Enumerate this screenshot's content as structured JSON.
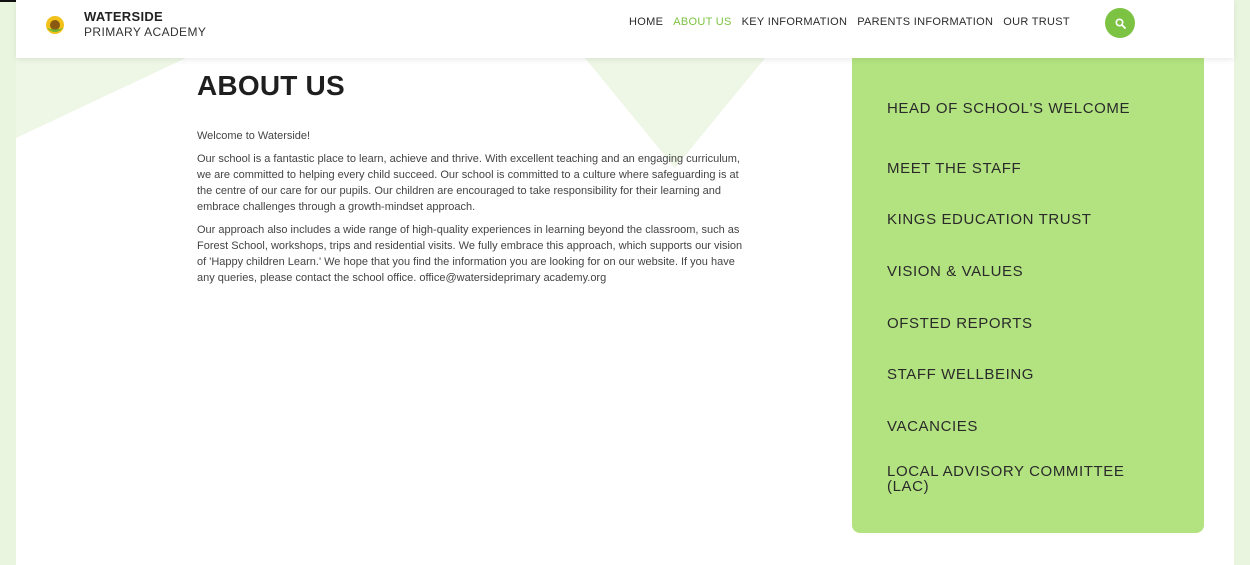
{
  "header": {
    "brand_top": "WATERSIDE",
    "brand_bottom": "PRIMARY ACADEMY",
    "nav": [
      "HOME",
      "ABOUT US",
      "KEY INFORMATION",
      "PARENTS INFORMATION",
      "OUR TRUST"
    ],
    "active_nav": "ABOUT US",
    "accent_color": "#7cc243"
  },
  "main": {
    "title": "ABOUT US",
    "paragraphs": [
      "Welcome to Waterside!",
      "Our school is a fantastic place to learn, achieve and thrive. With excellent teaching and an engaging curriculum, we are committed to helping every child succeed. Our school is committed to a culture where safeguarding is at the centre of our care for our pupils. Our children are encouraged to take responsibility for their learning and embrace challenges through a growth-mindset approach.",
      "Our approach also includes a wide range of high-quality experiences in learning beyond the classroom, such as Forest School, workshops, trips and residential visits. We fully embrace this approach, which supports our vision of 'Happy children Learn.' We hope that you find the information you are looking for on our website. If you have any queries, please contact the school office. office@watersideprimary academy.org"
    ]
  },
  "sidebar": {
    "items": [
      "HEAD OF SCHOOL'S WELCOME",
      "MEET THE STAFF",
      "KINGS EDUCATION TRUST",
      "VISION & VALUES",
      "OFSTED REPORTS",
      "STAFF WELLBEING",
      "VACANCIES",
      "LOCAL ADVISORY COMMITTEE (LAC)"
    ],
    "background_color": "#b3e380"
  },
  "icons": {
    "logo": "sunflower-logo-icon",
    "search": "search-icon"
  }
}
